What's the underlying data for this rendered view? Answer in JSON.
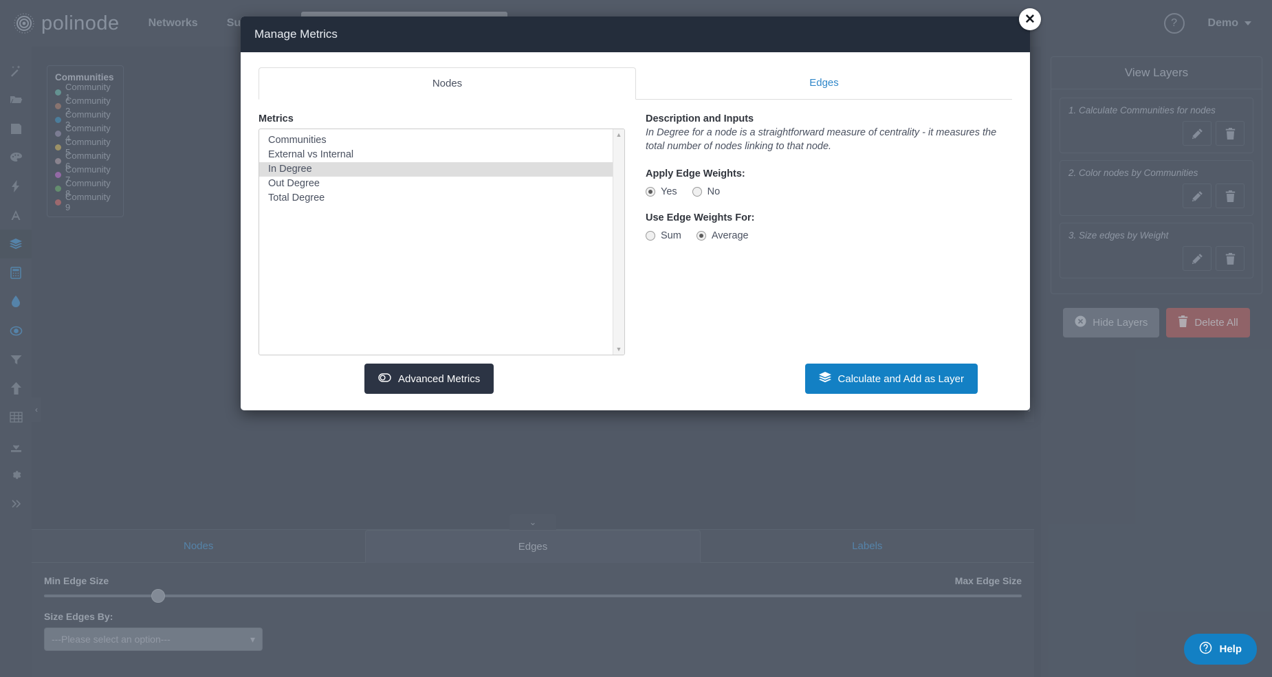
{
  "navbar": {
    "brand": "polinode",
    "brand_icon": "polinode-logo-icon",
    "links": [
      {
        "label": "Networks"
      },
      {
        "label": "Surveys"
      }
    ],
    "search_value": "",
    "help_icon_label": "?",
    "user_label": "Demo"
  },
  "rail": {
    "items": [
      {
        "name": "magic-wand-icon"
      },
      {
        "name": "folder-open-icon"
      },
      {
        "name": "save-icon"
      },
      {
        "name": "palette-icon"
      },
      {
        "name": "bolt-icon"
      },
      {
        "name": "text-icon"
      },
      {
        "name": "layers-icon"
      },
      {
        "name": "calculator-icon"
      },
      {
        "name": "droplet-icon"
      },
      {
        "name": "target-icon"
      },
      {
        "name": "filter-icon"
      },
      {
        "name": "arrow-up-icon"
      },
      {
        "name": "table-icon"
      },
      {
        "name": "download-icon"
      },
      {
        "name": "gear-icon"
      },
      {
        "name": "chevrons-right-icon"
      }
    ]
  },
  "legend": {
    "title": "Communities",
    "items": [
      {
        "label": "Community 1",
        "color": "#4fa596"
      },
      {
        "label": "Community 2",
        "color": "#9a6550"
      },
      {
        "label": "Community 3",
        "color": "#1b79ac"
      },
      {
        "label": "Community 4",
        "color": "#7d7899"
      },
      {
        "label": "Community 5",
        "color": "#c2a33e"
      },
      {
        "label": "Community 6",
        "color": "#9b8691"
      },
      {
        "label": "Community 7",
        "color": "#b050c0"
      },
      {
        "label": "Community 8",
        "color": "#4f9b4f"
      },
      {
        "label": "Community 9",
        "color": "#c4504f"
      }
    ]
  },
  "canvas": {
    "collapse_left_icon": "chevron-left-icon",
    "collapse_right_icon": "chevron-right-icon"
  },
  "right_panel": {
    "title": "View Layers",
    "layers": [
      {
        "label": "1. Calculate Communities for nodes",
        "edit_icon": "pencil-icon",
        "delete_icon": "trash-icon"
      },
      {
        "label": "2. Color nodes by Communities",
        "edit_icon": "pencil-icon",
        "delete_icon": "trash-icon"
      },
      {
        "label": "3. Size edges by Weight",
        "edit_icon": "pencil-icon",
        "delete_icon": "trash-icon"
      }
    ],
    "hide_layers_label": "Hide Layers",
    "hide_layers_icon": "circle-x-icon",
    "delete_all_label": "Delete All",
    "delete_all_icon": "trash-icon",
    "delete_all_color": "#a94442"
  },
  "bottom_panel": {
    "collapse_icon": "chevron-down-icon",
    "tabs": [
      {
        "label": "Nodes",
        "active": false
      },
      {
        "label": "Edges",
        "active": true
      },
      {
        "label": "Labels",
        "active": false
      }
    ],
    "min_edge_size_label": "Min Edge Size",
    "max_edge_size_label": "Max Edge Size",
    "slider_position_percent": 11,
    "size_edges_by_label": "Size Edges By:",
    "size_edges_by_value": "---Please select an option---",
    "dropdown_icon": "caret-down-icon"
  },
  "modal": {
    "title": "Manage Metrics",
    "close_icon": "close-icon",
    "tabs": [
      {
        "label": "Nodes",
        "active": true
      },
      {
        "label": "Edges",
        "active": false
      }
    ],
    "metrics_label": "Metrics",
    "metrics": [
      {
        "label": "Communities",
        "selected": false
      },
      {
        "label": "External vs Internal",
        "selected": false
      },
      {
        "label": "In Degree",
        "selected": true
      },
      {
        "label": "Out Degree",
        "selected": false
      },
      {
        "label": "Total Degree",
        "selected": false
      }
    ],
    "scroll_up_icon": "scroll-up-arrow-icon",
    "scroll_down_icon": "scroll-down-arrow-icon",
    "description_title": "Description and Inputs",
    "description_text": "In Degree for a node is a straightforward measure of centrality - it measures the total number of nodes linking to that node.",
    "apply_edge_weights_label": "Apply Edge Weights:",
    "apply_edge_weights_options": [
      {
        "label": "Yes",
        "selected": true
      },
      {
        "label": "No",
        "selected": false
      }
    ],
    "use_edge_weights_label": "Use Edge Weights For:",
    "use_edge_weights_options": [
      {
        "label": "Sum",
        "selected": false
      },
      {
        "label": "Average",
        "selected": true
      }
    ],
    "advanced_metrics_label": "Advanced Metrics",
    "advanced_metrics_icon": "toggle-icon",
    "calculate_label": "Calculate and Add as Layer",
    "calculate_icon": "layers-icon",
    "calculate_color": "#1380c4"
  },
  "help_widget": {
    "label": "Help",
    "icon": "question-circle-icon",
    "color": "#1380c4"
  }
}
